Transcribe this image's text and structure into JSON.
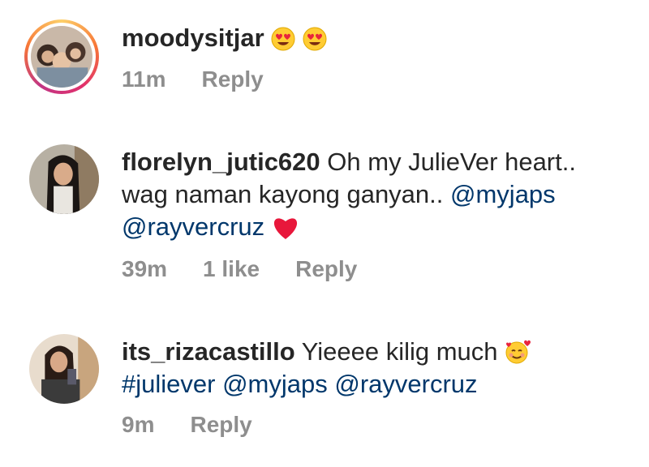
{
  "comments": [
    {
      "username": "moodysitjar",
      "text": "",
      "emojis": [
        "smiling-face-with-heart-eyes",
        "smiling-face-with-heart-eyes"
      ],
      "time": "11m",
      "likes": "",
      "reply": "Reply"
    },
    {
      "username": "florelyn_jutic620",
      "text": "Oh my JulieVer heart.. wag naman kayong ganyan..",
      "mentions": [
        "@myjaps",
        "@rayvercruz"
      ],
      "emojis": [
        "red-heart"
      ],
      "time": "39m",
      "likes": "1 like",
      "reply": "Reply"
    },
    {
      "username": "its_rizacastillo",
      "text": "Yieeee kilig much",
      "emojis": [
        "smiling-face-with-hearts"
      ],
      "mentions": [
        "#julieve",
        "@myjaps",
        "@rayvercruz"
      ],
      "hashtag": "#juliever",
      "time": "9m",
      "reply": "Reply"
    }
  ],
  "colors": {
    "username": "#262626",
    "mention": "#00376b",
    "meta": "#8e8e8e",
    "background": "#ffffff"
  }
}
